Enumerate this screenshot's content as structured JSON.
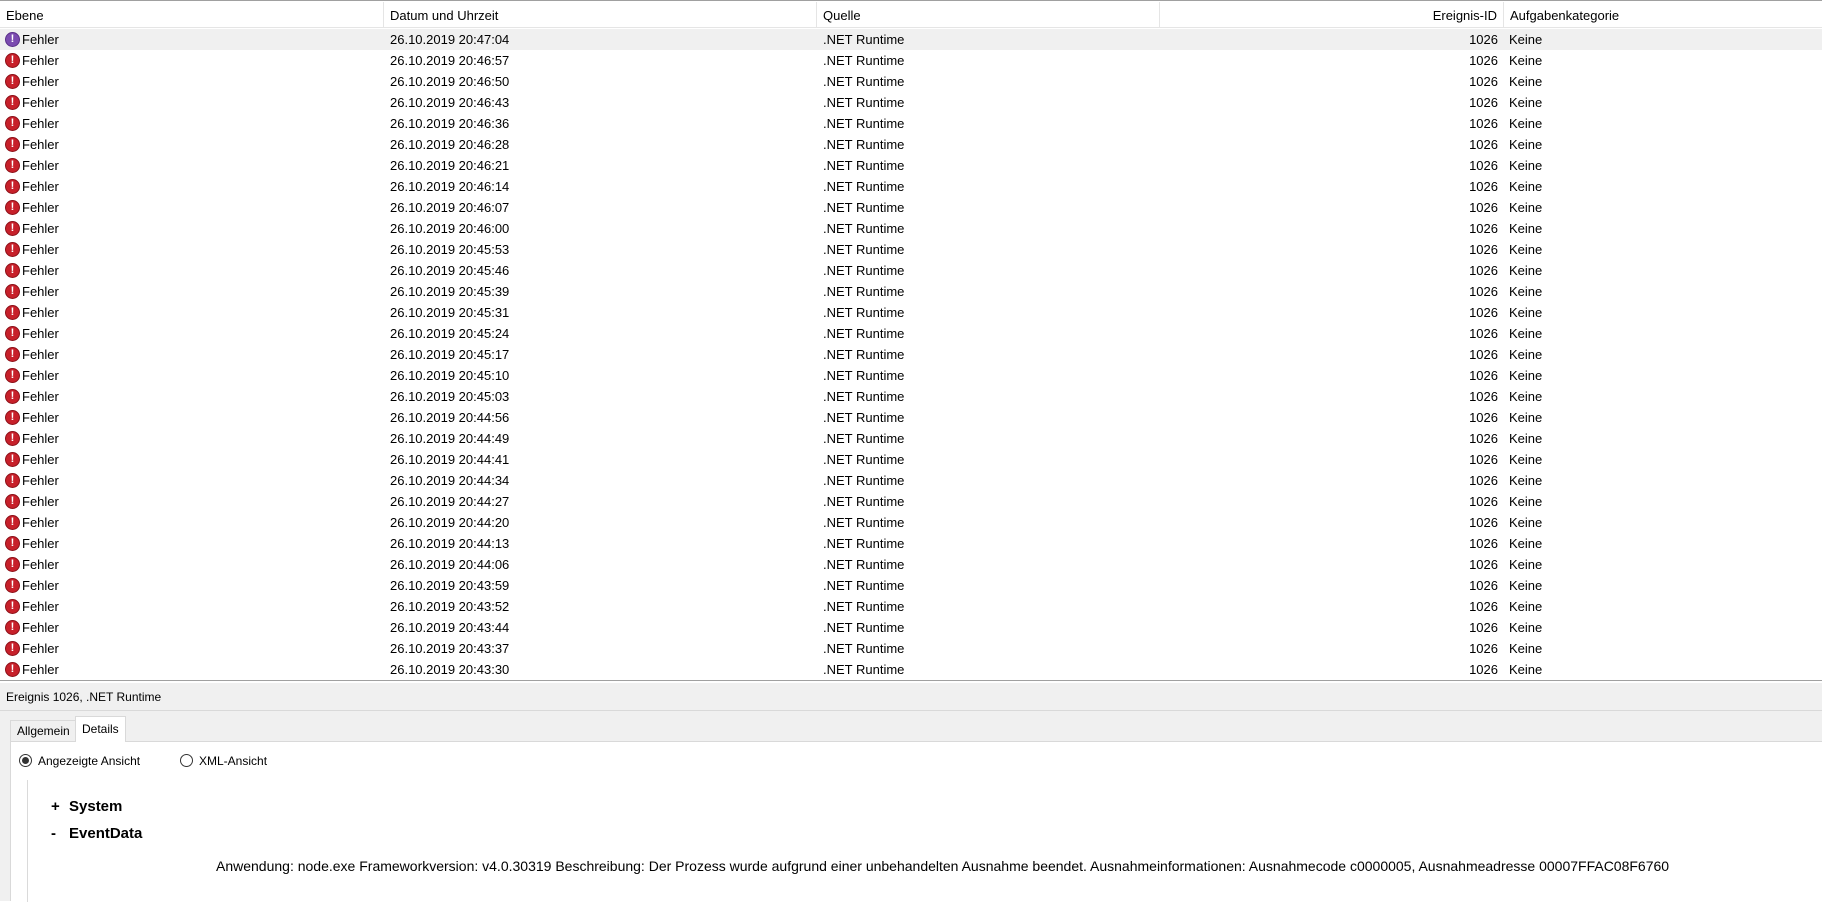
{
  "columns": {
    "level": "Ebene",
    "datetime": "Datum und Uhrzeit",
    "source": "Quelle",
    "event_id": "Ereignis-ID",
    "category": "Aufgabenkategorie"
  },
  "events": [
    {
      "level": "Fehler",
      "datetime": "26.10.2019 20:47:04",
      "source": ".NET Runtime",
      "event_id": "1026",
      "category": "Keine"
    },
    {
      "level": "Fehler",
      "datetime": "26.10.2019 20:46:57",
      "source": ".NET Runtime",
      "event_id": "1026",
      "category": "Keine"
    },
    {
      "level": "Fehler",
      "datetime": "26.10.2019 20:46:50",
      "source": ".NET Runtime",
      "event_id": "1026",
      "category": "Keine"
    },
    {
      "level": "Fehler",
      "datetime": "26.10.2019 20:46:43",
      "source": ".NET Runtime",
      "event_id": "1026",
      "category": "Keine"
    },
    {
      "level": "Fehler",
      "datetime": "26.10.2019 20:46:36",
      "source": ".NET Runtime",
      "event_id": "1026",
      "category": "Keine"
    },
    {
      "level": "Fehler",
      "datetime": "26.10.2019 20:46:28",
      "source": ".NET Runtime",
      "event_id": "1026",
      "category": "Keine"
    },
    {
      "level": "Fehler",
      "datetime": "26.10.2019 20:46:21",
      "source": ".NET Runtime",
      "event_id": "1026",
      "category": "Keine"
    },
    {
      "level": "Fehler",
      "datetime": "26.10.2019 20:46:14",
      "source": ".NET Runtime",
      "event_id": "1026",
      "category": "Keine"
    },
    {
      "level": "Fehler",
      "datetime": "26.10.2019 20:46:07",
      "source": ".NET Runtime",
      "event_id": "1026",
      "category": "Keine"
    },
    {
      "level": "Fehler",
      "datetime": "26.10.2019 20:46:00",
      "source": ".NET Runtime",
      "event_id": "1026",
      "category": "Keine"
    },
    {
      "level": "Fehler",
      "datetime": "26.10.2019 20:45:53",
      "source": ".NET Runtime",
      "event_id": "1026",
      "category": "Keine"
    },
    {
      "level": "Fehler",
      "datetime": "26.10.2019 20:45:46",
      "source": ".NET Runtime",
      "event_id": "1026",
      "category": "Keine"
    },
    {
      "level": "Fehler",
      "datetime": "26.10.2019 20:45:39",
      "source": ".NET Runtime",
      "event_id": "1026",
      "category": "Keine"
    },
    {
      "level": "Fehler",
      "datetime": "26.10.2019 20:45:31",
      "source": ".NET Runtime",
      "event_id": "1026",
      "category": "Keine"
    },
    {
      "level": "Fehler",
      "datetime": "26.10.2019 20:45:24",
      "source": ".NET Runtime",
      "event_id": "1026",
      "category": "Keine"
    },
    {
      "level": "Fehler",
      "datetime": "26.10.2019 20:45:17",
      "source": ".NET Runtime",
      "event_id": "1026",
      "category": "Keine"
    },
    {
      "level": "Fehler",
      "datetime": "26.10.2019 20:45:10",
      "source": ".NET Runtime",
      "event_id": "1026",
      "category": "Keine"
    },
    {
      "level": "Fehler",
      "datetime": "26.10.2019 20:45:03",
      "source": ".NET Runtime",
      "event_id": "1026",
      "category": "Keine"
    },
    {
      "level": "Fehler",
      "datetime": "26.10.2019 20:44:56",
      "source": ".NET Runtime",
      "event_id": "1026",
      "category": "Keine"
    },
    {
      "level": "Fehler",
      "datetime": "26.10.2019 20:44:49",
      "source": ".NET Runtime",
      "event_id": "1026",
      "category": "Keine"
    },
    {
      "level": "Fehler",
      "datetime": "26.10.2019 20:44:41",
      "source": ".NET Runtime",
      "event_id": "1026",
      "category": "Keine"
    },
    {
      "level": "Fehler",
      "datetime": "26.10.2019 20:44:34",
      "source": ".NET Runtime",
      "event_id": "1026",
      "category": "Keine"
    },
    {
      "level": "Fehler",
      "datetime": "26.10.2019 20:44:27",
      "source": ".NET Runtime",
      "event_id": "1026",
      "category": "Keine"
    },
    {
      "level": "Fehler",
      "datetime": "26.10.2019 20:44:20",
      "source": ".NET Runtime",
      "event_id": "1026",
      "category": "Keine"
    },
    {
      "level": "Fehler",
      "datetime": "26.10.2019 20:44:13",
      "source": ".NET Runtime",
      "event_id": "1026",
      "category": "Keine"
    },
    {
      "level": "Fehler",
      "datetime": "26.10.2019 20:44:06",
      "source": ".NET Runtime",
      "event_id": "1026",
      "category": "Keine"
    },
    {
      "level": "Fehler",
      "datetime": "26.10.2019 20:43:59",
      "source": ".NET Runtime",
      "event_id": "1026",
      "category": "Keine"
    },
    {
      "level": "Fehler",
      "datetime": "26.10.2019 20:43:52",
      "source": ".NET Runtime",
      "event_id": "1026",
      "category": "Keine"
    },
    {
      "level": "Fehler",
      "datetime": "26.10.2019 20:43:44",
      "source": ".NET Runtime",
      "event_id": "1026",
      "category": "Keine"
    },
    {
      "level": "Fehler",
      "datetime": "26.10.2019 20:43:37",
      "source": ".NET Runtime",
      "event_id": "1026",
      "category": "Keine"
    },
    {
      "level": "Fehler",
      "datetime": "26.10.2019 20:43:30",
      "source": ".NET Runtime",
      "event_id": "1026",
      "category": "Keine"
    }
  ],
  "error_icon": {
    "name": "error-icon",
    "glyph": "!",
    "color": "#c7202a",
    "selected_color": "#7b4bb0"
  },
  "details": {
    "title": "Ereignis 1026, .NET Runtime",
    "tabs": [
      {
        "label": "Allgemein",
        "active": false
      },
      {
        "label": "Details",
        "active": true
      }
    ],
    "view_options": [
      {
        "label": "Angezeigte Ansicht",
        "checked": true
      },
      {
        "label": "XML-Ansicht",
        "checked": false
      }
    ],
    "tree": {
      "system": {
        "toggle": "+",
        "label": "System"
      },
      "eventdata": {
        "toggle": "-",
        "label": "EventData"
      }
    },
    "event_text": "Anwendung: node.exe Frameworkversion: v4.0.30319 Beschreibung: Der Prozess wurde aufgrund einer unbehandelten Ausnahme beendet. Ausnahmeinformationen: Ausnahmecode c0000005, Ausnahmeadresse 00007FFAC08F6760"
  }
}
